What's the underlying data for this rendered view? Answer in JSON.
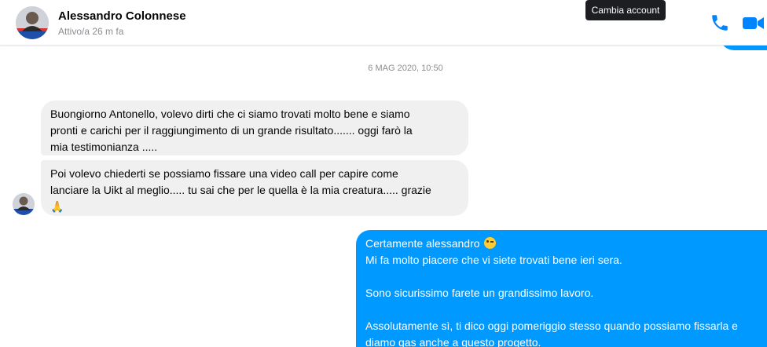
{
  "header": {
    "contact_name": "Alessandro Colonnese",
    "status": "Attivo/a 26 m fa",
    "tooltip": "Cambia account",
    "icons": [
      "phone-icon",
      "video-camera-icon"
    ],
    "accent_color": "#0099ff"
  },
  "conversation": {
    "timestamp": "6 MAG 2020, 10:50",
    "received": [
      {
        "lines": [
          "Buongiorno Antonello, volevo dirti che ci siamo trovati molto bene e siamo",
          "pronti e carichi per il raggiungimento di un grande risultato....... oggi farò la",
          "mia testimonianza ....."
        ]
      },
      {
        "lines": [
          "Poi volevo chiederti se possiamo fissare una video call per capire come",
          "lanciare la Uikt al meglio..... tu sai che per le quella è la mia creatura..... grazie"
        ],
        "emoji": "🙏"
      }
    ],
    "sent": {
      "line1": "Certamente alessandro",
      "line2": "Mi fa molto piacere che vi siete trovati bene ieri sera.",
      "line3": "Sono sicurissimo farete un grandissimo lavoro.",
      "line4": "Assolutamente sì, ti dico oggi pomeriggio stesso quando possiamo fissarla e",
      "line5": "diamo gas anche a questo progetto."
    }
  }
}
